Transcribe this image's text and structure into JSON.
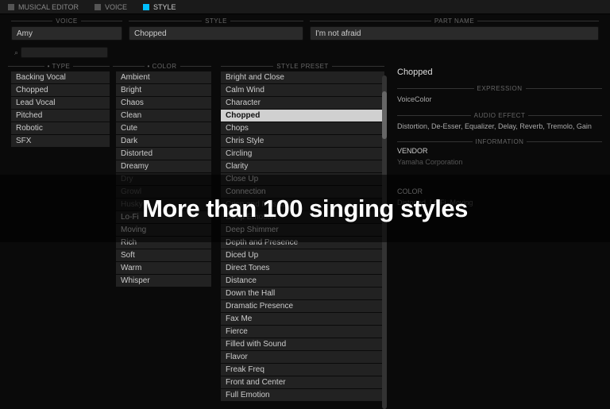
{
  "tabs": [
    {
      "label": "MUSICAL EDITOR",
      "active": false
    },
    {
      "label": "VOICE",
      "active": false
    },
    {
      "label": "STYLE",
      "active": true
    }
  ],
  "header": {
    "voice_label": "VOICE",
    "voice_value": "Amy",
    "style_label": "STYLE",
    "style_value": "Chopped",
    "part_label": "PART NAME",
    "part_value": "I'm not afraid"
  },
  "search": {
    "placeholder": ""
  },
  "columns": {
    "type": {
      "header": "• TYPE",
      "items": [
        "Backing Vocal",
        "Chopped",
        "Lead Vocal",
        "Pitched",
        "Robotic",
        "SFX"
      ]
    },
    "color": {
      "header": "• COLOR",
      "items": [
        "Ambient",
        "Bright",
        "Chaos",
        "Clean",
        "Cute",
        "Dark",
        "Distorted",
        "Dreamy",
        "Dry",
        "Growl",
        "Husky",
        "Lo-Fi",
        "Moving",
        "Rich",
        "Soft",
        "Warm",
        "Whisper"
      ]
    },
    "preset": {
      "header": "STYLE PRESET",
      "selected": "Chopped",
      "items": [
        "Bright and Close",
        "Calm Wind",
        "Character",
        "Chopped",
        "Chops",
        "Chris Style",
        "Circling",
        "Clarity",
        "Close Up",
        "Connection",
        "Crisp and Musical",
        "Deep Emotion",
        "Deep Shimmer",
        "Depth and Presence",
        "Diced Up",
        "Direct Tones",
        "Distance",
        "Down the Hall",
        "Dramatic Presence",
        "Fax Me",
        "Fierce",
        "Filled with Sound",
        "Flavor",
        "Freak Freq",
        "Front and Center",
        "Full Emotion"
      ]
    }
  },
  "detail": {
    "title": "Chopped",
    "expression_label": "EXPRESSION",
    "expression": "VoiceColor",
    "audio_effect_label": "AUDIO EFFECT",
    "audio_effect": "Distortion, De-Esser, Equalizer, Delay, Reverb, Tremolo, Gain",
    "information_label": "INFORMATION",
    "vendor_label": "VENDOR",
    "vendor": "Yamaha Corporation",
    "color_label": "COLOR",
    "color": "Distorted, Lo-Fi, Moving"
  },
  "overlay": "More than 100 singing styles"
}
